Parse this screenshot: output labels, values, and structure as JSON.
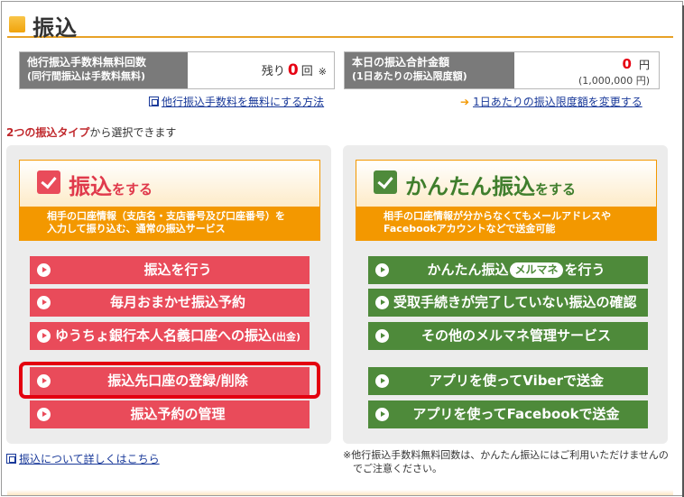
{
  "header": {
    "title": "振込"
  },
  "fee_box": {
    "label": "他行振込手数料無料回数",
    "sublabel": "(同行間振込は手数料無料)",
    "remain_prefix": "残り",
    "remain_count": "0",
    "remain_unit": "回",
    "mark": "※"
  },
  "amount_box": {
    "label": "本日の振込合計金額",
    "sublabel": "(1日あたりの振込限度額)",
    "amount": "0",
    "unit": "円",
    "limit": "(1,000,000 円)"
  },
  "links": {
    "free_fee": "他行振込手数料を無料にする方法",
    "change_limit": "1日あたりの振込限度額を変更する",
    "details": "振込について詳しくはこちら"
  },
  "intro": {
    "highlight": "2つの振込タイプ",
    "rest": "から選択できます"
  },
  "left_panel": {
    "title_main": "振込",
    "title_suffix": "をする",
    "desc_line1": "相手の口座情報（支店名・支店番号及び口座番号）を",
    "desc_line2": "入力して振り込む、通常の振込サービス",
    "buttons": {
      "b1": "振込を行う",
      "b2": "毎月おまかせ振込予約",
      "b3_main": "ゆうちょ銀行本人名義口座への振込",
      "b3_small": "(出金)",
      "b4": "振込先口座の登録/削除",
      "b5": "振込予約の管理"
    }
  },
  "right_panel": {
    "title_main": "かんたん振込",
    "title_suffix": "をする",
    "desc_line1": "相手の口座情報が分からなくてもメールアドレスや",
    "desc_line2": "Facebookアカウントなどで送金可能",
    "buttons": {
      "b1_pre": "かんたん振込",
      "b1_badge": "メルマネ",
      "b1_post": "を行う",
      "b2": "受取手続きが完了していない振込の確認",
      "b3": "その他のメルマネ管理サービス",
      "b4": "アプリを使ってViberで送金",
      "b5": "アプリを使ってFacebookで送金"
    }
  },
  "note": {
    "line1": "※他行振込手数料無料回数は、かんたん振込にはご利用いただけませんの",
    "line2": "でご注意ください。"
  },
  "colors": {
    "red": "#e94b5a",
    "green": "#4e8a3a",
    "orange": "#f39800",
    "highlight": "#e3000f"
  }
}
